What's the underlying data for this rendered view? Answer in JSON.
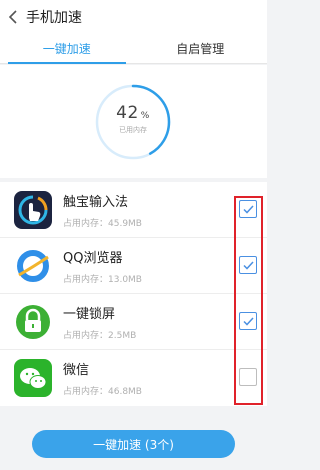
{
  "header": {
    "title": "手机加速",
    "back_icon": "chevron-left-icon"
  },
  "tabs": [
    {
      "label": "一键加速",
      "active": true
    },
    {
      "label": "自启管理",
      "active": false
    }
  ],
  "memory": {
    "percent": "42",
    "unit": "%",
    "caption": "已用内存",
    "fraction": 0.42,
    "ring_color": "#2e9ee8"
  },
  "apps": [
    {
      "name": "触宝输入法",
      "memory": "占用内存：45.9MB",
      "checked": true,
      "icon": "touchpal-icon"
    },
    {
      "name": "QQ浏览器",
      "memory": "占用内存：13.0MB",
      "checked": true,
      "icon": "qq-browser-icon"
    },
    {
      "name": "一键锁屏",
      "memory": "占用内存：2.5MB",
      "checked": true,
      "icon": "lock-screen-icon"
    },
    {
      "name": "微信",
      "memory": "占用内存：46.8MB",
      "checked": false,
      "icon": "wechat-icon"
    }
  ],
  "footer": {
    "button_label": "一键加速 (3个)"
  },
  "colors": {
    "accent": "#2e9ee8",
    "button": "#3aa3ea",
    "highlight": "#e0222a",
    "check": "#4a90e2"
  }
}
